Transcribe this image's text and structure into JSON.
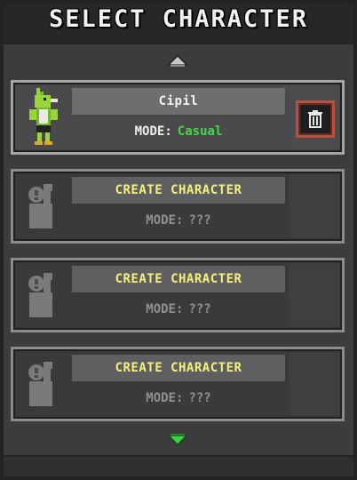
{
  "header": {
    "title": "SELECT CHARACTER"
  },
  "colors": {
    "casual_mode": "#47d64b",
    "create_text": "#f5f07a",
    "delete_border": "#b5523f"
  },
  "slots": [
    {
      "state": "character",
      "name": "Cipil",
      "mode_label": "MODE:",
      "mode_value": "Casual",
      "portrait_icon": "green-bird-character"
    },
    {
      "state": "empty",
      "name": "CREATE CHARACTER",
      "mode_label": "MODE:",
      "mode_value": "???",
      "portrait_icon": "unknown-character-silhouette"
    },
    {
      "state": "empty",
      "name": "CREATE CHARACTER",
      "mode_label": "MODE:",
      "mode_value": "???",
      "portrait_icon": "unknown-character-silhouette"
    },
    {
      "state": "empty",
      "name": "CREATE CHARACTER",
      "mode_label": "MODE:",
      "mode_value": "???",
      "portrait_icon": "unknown-character-silhouette"
    }
  ],
  "icons": {
    "scroll_up": "arrow-up-icon",
    "scroll_down": "arrow-down-icon",
    "delete": "trash-icon"
  }
}
